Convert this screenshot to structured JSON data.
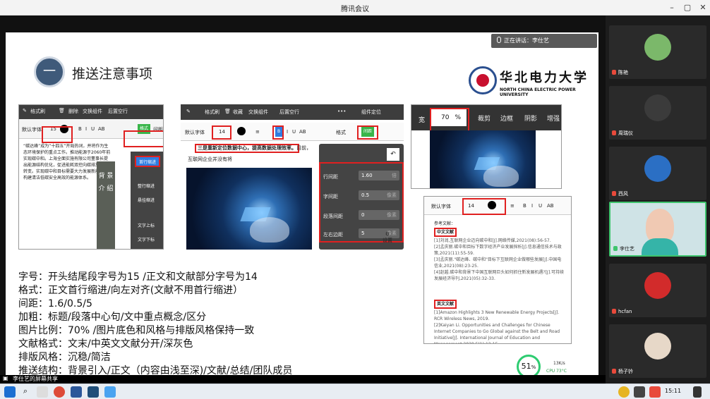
{
  "window": {
    "title": "腾讯会议"
  },
  "speaking": {
    "label": "正在讲话：李仕艺"
  },
  "slide": {
    "number": "一",
    "title": "推送注意事项",
    "university_cn": "华北电力大学",
    "university_en": "NORTH CHINA ELECTRIC POWER UNIVERSITY",
    "rules": [
      "字号：开头结尾段字号为15 /正文和文献部分字号为14",
      "格式：正文首行缩进/向左对齐(文献不用首行缩进）",
      "间距：1.6/0.5/5",
      "加粗：标题/段落中心句/文中重点概念/区分",
      "图片比例：70% /图片底色和风格与排版风格保持一致",
      "文献格式：文末/中英文文献分开/深灰色",
      "排版风格：沉稳/简洁",
      "推送结构：背景引入/正文（内容由浅至深)/文献/总结/团队成员"
    ]
  },
  "panel1": {
    "toolbar_top": [
      "撤销",
      "格式刷",
      "删除",
      "交换组件",
      "后置空行"
    ],
    "font_label": "默认字体",
    "font_size": "15",
    "format_buttons": [
      "B",
      "I",
      "U",
      "AB",
      "格式",
      "间距"
    ],
    "menu_first": "首行缩进",
    "menu_items": [
      "首行缩进",
      "整行缩进",
      "悬挂缩进",
      "文字上标",
      "文字下标"
    ],
    "side_title": "背 景 介 绍",
    "body_text": "“碳达峰”成为“十四五”开局热词，并将作为生态环境保护的重点工作。推动能源于2060年前实现碳中和。上海全面实施有限公司董事长提出能源结构优化，促进能耗双控向碳排放双控转变。实现碳中和目标需要大力发展新能源，构建清洁低碳安全高效的能源体系。"
  },
  "panel2": {
    "toolbar_top": [
      "撤销",
      "格式刷",
      "删除",
      "收藏",
      "交换组件",
      "后置空行",
      "组件定位"
    ],
    "font_label": "默认字体",
    "font_size": "14",
    "format_buttons": [
      "B",
      "I",
      "U",
      "AB",
      "格式"
    ],
    "spacing_button": "间距",
    "highlight_text": "三是重新定位数据中心，提高数据处理效率。",
    "highlight_tail": "目前，",
    "line2": "互联网企业并没有将",
    "params": [
      {
        "label": "行间距",
        "value": "1.60",
        "unit": "倍"
      },
      {
        "label": "字间距",
        "value": "0.5",
        "unit": "像素"
      },
      {
        "label": "段落间距",
        "value": "0",
        "unit": "像素"
      },
      {
        "label": "左右边距",
        "value": "5",
        "unit": "像素"
      }
    ],
    "settings_label": "设置"
  },
  "panel3": {
    "width_label": "宽",
    "width_value": "70",
    "unit": "%",
    "tools": [
      "裁剪",
      "边框",
      "阴影",
      "增强"
    ]
  },
  "panel4": {
    "font_label": "默认字体",
    "font_size": "14",
    "ref_heading": "参考文献：",
    "cn_label": "中文文献",
    "cn_refs": [
      "[1]刘润,互联网企业迈向碳中和[J].网络传媒,2021(08):56-57.",
      "[2]孟庆丽.碳中和目标下数字经济产业发展探析[J].信息通信技术与政策,2021(11):55-59.",
      "[3]孟庆丽.\"碳达峰、碳中和\"目标下互联网企业做哪些发展[J].中国电信业,2021(08):23-25.",
      "[4]赵越.碳中和背景下中国互联网巨头如何抓住新发展机遇?[J].可持续发展经济导刊,2021(05):32-33."
    ],
    "en_label": "英文文献",
    "en_refs": [
      "[1]Amazon Highlights 3 New Renewable Energy Projects[J]. RCR Wireless News, 2019.",
      "[2]Kaiyan Li. Opportunities and Challenges for Chinese Internet Companies to Go Global against the Belt and Road Initiative[J]. International Journal of Education and Management,2020,5(1):12-15."
    ]
  },
  "gauge": {
    "value": "51",
    "unit": "%",
    "net": "13K/s",
    "cpu": "CPU 73°C"
  },
  "share_bar": {
    "label": "李仕艺的屏幕共享"
  },
  "participants": [
    {
      "name": "陈艳",
      "avatar_color": "#7bb86a"
    },
    {
      "name": "周瑞仪",
      "avatar_color": "#3b3b3b"
    },
    {
      "name": "西风",
      "avatar_color": "#2b6fc4"
    },
    {
      "name": "李仕艺",
      "avatar_color": "#f0c9b3"
    },
    {
      "name": "hcfan",
      "avatar_color": "#d22b2b"
    },
    {
      "name": "杨子钤",
      "avatar_color": "#e7d8c8"
    }
  ],
  "taskbar": {
    "time": "15:11"
  }
}
